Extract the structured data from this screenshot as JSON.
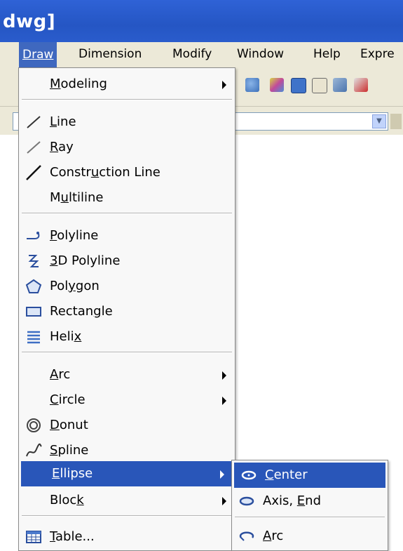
{
  "window": {
    "title": "dwg]"
  },
  "menubar": {
    "items": [
      "Draw",
      "Dimension",
      "Modify",
      "Window",
      "Help",
      "Expre"
    ]
  },
  "toolbar": {
    "icons": [
      "pan-icon",
      "properties-icon",
      "table-icon",
      "publish-icon",
      "tool-palette-icon",
      "sheet-icon"
    ]
  },
  "draw_menu": {
    "modeling": {
      "label": "Modeling",
      "has_submenu": true
    },
    "line": {
      "label": "Line",
      "icon": "line-icon"
    },
    "ray": {
      "label": "Ray",
      "icon": "ray-icon"
    },
    "construction_line": {
      "label": "Construction Line",
      "icon": "construction-line-icon"
    },
    "multiline": {
      "label": "Multiline"
    },
    "polyline": {
      "label": "Polyline",
      "icon": "polyline-icon"
    },
    "polyline3d": {
      "label": "3D Polyline",
      "icon": "3d-polyline-icon"
    },
    "polygon": {
      "label": "Polygon",
      "icon": "polygon-icon"
    },
    "rectangle": {
      "label": "Rectangle",
      "icon": "rectangle-icon"
    },
    "helix": {
      "label": "Helix",
      "icon": "helix-icon"
    },
    "arc": {
      "label": "Arc",
      "has_submenu": true
    },
    "circle": {
      "label": "Circle",
      "has_submenu": true
    },
    "donut": {
      "label": "Donut",
      "icon": "donut-icon"
    },
    "spline": {
      "label": "Spline",
      "icon": "spline-icon"
    },
    "ellipse": {
      "label": "Ellipse",
      "has_submenu": true,
      "highlighted": true
    },
    "block": {
      "label": "Block",
      "has_submenu": true
    },
    "table": {
      "label": "Table...",
      "icon": "table-icon"
    }
  },
  "ellipse_submenu": {
    "center": {
      "label": "Center",
      "icon": "ellipse-center-icon",
      "highlighted": true
    },
    "axis_end": {
      "label": "Axis, End",
      "icon": "ellipse-axis-end-icon"
    },
    "arc": {
      "label": "Arc",
      "icon": "ellipse-arc-icon"
    }
  },
  "colors": {
    "title_bar": "#2556c4",
    "highlight": "#2956b9",
    "menu_bg": "#f8f8f8",
    "chrome_bg": "#ece9d8"
  }
}
